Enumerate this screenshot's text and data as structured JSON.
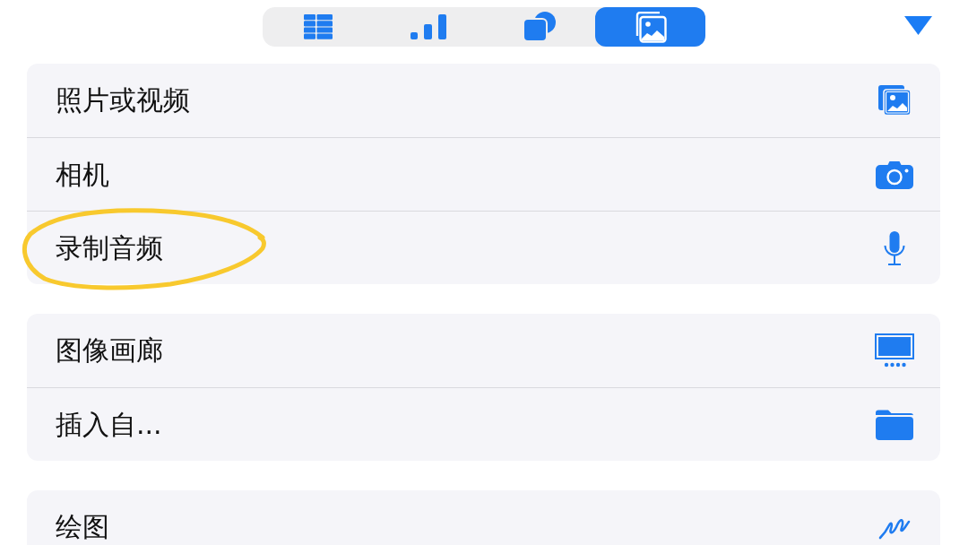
{
  "segmented_control": {
    "segments": [
      {
        "selected": false
      },
      {
        "selected": false
      },
      {
        "selected": false
      },
      {
        "selected": true
      }
    ]
  },
  "groups": [
    {
      "items": [
        {
          "label": "照片或视频",
          "circled": false
        },
        {
          "label": "相机",
          "circled": false
        },
        {
          "label": "录制音频",
          "circled": true
        }
      ]
    },
    {
      "items": [
        {
          "label": "图像画廊",
          "circled": false
        },
        {
          "label": "插入自...",
          "circled": false
        }
      ]
    },
    {
      "items": [
        {
          "label": "绘图",
          "circled": false
        }
      ]
    }
  ]
}
